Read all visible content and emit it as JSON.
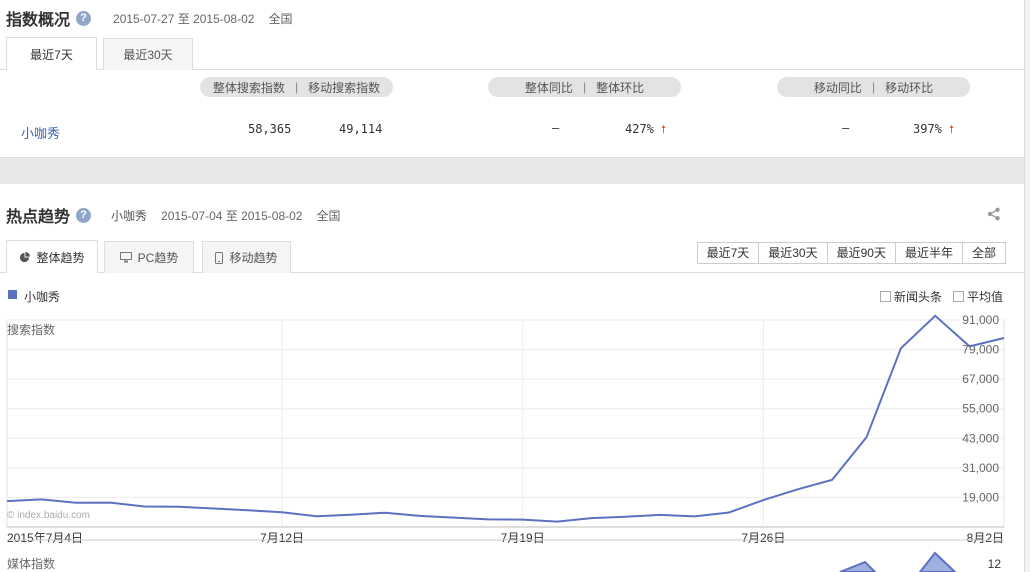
{
  "overview": {
    "title": "指数概况",
    "help_glyph": "?",
    "date_range": "2015-07-27 至 2015-08-02",
    "region": "全国",
    "tabs": [
      "最近7天",
      "最近30天"
    ],
    "header_search": [
      "整体搜索指数",
      "|",
      "移动搜索指数"
    ],
    "header_yoy": [
      "整体同比",
      "|",
      "整体环比"
    ],
    "header_mobile": [
      "移动同比",
      "|",
      "移动环比"
    ],
    "row": {
      "keyword": "小咖秀",
      "overall_search": "58,365",
      "mobile_search": "49,114",
      "overall_yoy": "—",
      "overall_mom": "427%",
      "mobile_yoy": "—",
      "mobile_mom": "397%",
      "up_arrow": "🠕"
    }
  },
  "trend": {
    "title": "热点趋势",
    "help_glyph": "?",
    "keyword": "小咖秀",
    "date_range": "2015-07-04 至 2015-08-02",
    "region": "全国",
    "share_icon": "share-icon",
    "tabs": [
      "整体趋势",
      "PC趋势",
      "移动趋势"
    ],
    "range_buttons": [
      "最近7天",
      "最近30天",
      "最近90天",
      "最近半年",
      "全部"
    ],
    "legend_label": "小咖秀",
    "checkbox_news": "新闻头条",
    "checkbox_avg": "平均值",
    "watermark": "© index.baidu.com",
    "media_label": "媒体指数",
    "media_tick": "12"
  },
  "chart_data": {
    "type": "line",
    "title": "",
    "ylabel": "搜索指数",
    "x_tick_labels": [
      "2015年7月4日",
      "7月12日",
      "7月19日",
      "7月26日",
      "8月2日"
    ],
    "y_tick_labels": [
      "91,000",
      "79,000",
      "67,000",
      "55,000",
      "43,000",
      "31,000",
      "19,000"
    ],
    "ylim": [
      7000,
      91000
    ],
    "grid": true,
    "line_color": "#5b72c0",
    "series": [
      {
        "name": "小咖秀",
        "x": [
          "07-04",
          "07-05",
          "07-06",
          "07-07",
          "07-08",
          "07-09",
          "07-10",
          "07-11",
          "07-12",
          "07-13",
          "07-14",
          "07-15",
          "07-16",
          "07-17",
          "07-18",
          "07-19",
          "07-20",
          "07-21",
          "07-22",
          "07-23",
          "07-24",
          "07-25",
          "07-26",
          "07-27",
          "07-28",
          "07-29",
          "07-30",
          "07-31",
          "08-01",
          "08-02"
        ],
        "values": [
          17500,
          18200,
          16800,
          16900,
          15300,
          15200,
          14500,
          13800,
          13000,
          11400,
          12000,
          12800,
          11500,
          10800,
          10100,
          10000,
          9200,
          10600,
          11200,
          11900,
          11300,
          12900,
          17900,
          22300,
          26100,
          43400,
          79500,
          92700,
          80300,
          83700
        ]
      }
    ],
    "media_series": {
      "name": "媒体指数",
      "ytick": "12"
    }
  }
}
